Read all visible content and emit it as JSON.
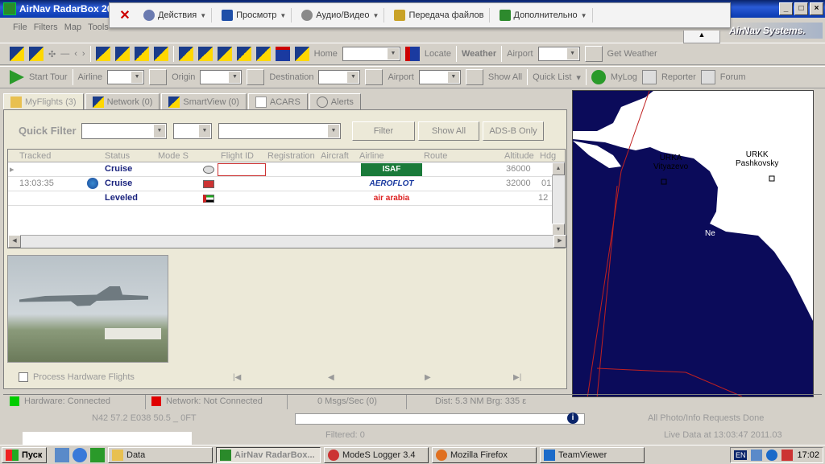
{
  "window": {
    "title": "AirNav RadarBox 20",
    "brand": "AirNav Systems."
  },
  "popup": {
    "items": [
      {
        "label": "Действия",
        "icon": "gear-icon",
        "color": "#6a7ab0"
      },
      {
        "label": "Просмотр",
        "icon": "monitor-icon",
        "color": "#1f4fa8"
      },
      {
        "label": "Аудио/Видео",
        "icon": "speaker-icon",
        "color": "#8a8a8a"
      },
      {
        "label": "Передача файлов",
        "icon": "file-transfer-icon",
        "color": "#c9a227"
      },
      {
        "label": "Дополнительно",
        "icon": "puzzle-icon",
        "color": "#2d8a2d"
      }
    ]
  },
  "menu": [
    "File",
    "Filters",
    "Map",
    "Tools"
  ],
  "toolbar1": {
    "home": "Home",
    "locate": "Locate",
    "weather": "Weather",
    "airport": "Airport",
    "get_weather": "Get Weather"
  },
  "toolbar2": {
    "start_tour": "Start Tour",
    "airline": "Airline",
    "origin": "Origin",
    "destination": "Destination",
    "airport": "Airport",
    "show_all": "Show All",
    "quick_list": "Quick List",
    "mylog": "MyLog",
    "reporter": "Reporter",
    "forum": "Forum"
  },
  "tabs": [
    {
      "label": "MyFlights (3)",
      "icon": "myflights-icon"
    },
    {
      "label": "Network (0)",
      "icon": "network-icon"
    },
    {
      "label": "SmartView (0)",
      "icon": "smartview-icon"
    },
    {
      "label": "ACARS",
      "icon": "acars-icon"
    },
    {
      "label": "Alerts",
      "icon": "alerts-icon"
    }
  ],
  "quick_filter": {
    "label": "Quick Filter",
    "filter_btn": "Filter",
    "show_all_btn": "Show All",
    "adsb_btn": "ADS-B Only"
  },
  "grid": {
    "columns": [
      "Tracked",
      "Status",
      "Mode S",
      "Flight ID",
      "Registration",
      "Aircraft",
      "Airline",
      "Route",
      "Altitude",
      "Hdg"
    ],
    "rows": [
      {
        "tracked": "",
        "status": "Cruise",
        "flag": "#d22",
        "airline": "ISAF",
        "airline_bg": "#1a7a3a",
        "airline_color": "#fff",
        "altitude": "36000",
        "hdg": ""
      },
      {
        "tracked": "13:03:35",
        "status": "Cruise",
        "flag": "#c33",
        "airline": "AEROFLOT",
        "airline_bg": "#fff",
        "airline_color": "#1a3aa0",
        "altitude": "32000",
        "hdg": "01:"
      },
      {
        "tracked": "",
        "status": "Leveled",
        "flag": "#2a2",
        "airline": "air arabia",
        "airline_bg": "#fff",
        "airline_color": "#d22",
        "altitude": "12",
        "hdg": ""
      }
    ]
  },
  "hardware_flights": "Process Hardware Flights",
  "map": {
    "labels": [
      {
        "code": "URKA",
        "name": "Vityazevo"
      },
      {
        "code": "URKK",
        "name": "Pashkovsky"
      },
      {
        "code": "Ne",
        "name": ""
      }
    ]
  },
  "status": {
    "hardware": "Hardware: Connected",
    "hardware_color": "#00cc00",
    "network": "Network: Not Connected",
    "network_color": "#e00000",
    "msgs": "0 Msgs/Sec (0)",
    "dist": "Dist: 5.3 NM   Brg: 335 ε"
  },
  "position": {
    "coord": "N42 57.2 E038 50.5 _ 0FT",
    "info_icon": "i",
    "done": "All Photo/Info Requests Done"
  },
  "bottom": {
    "filtered": "Filtered: 0",
    "live": "Live Data at 13:03:47 2011.03"
  },
  "taskbar": {
    "start": "Пуск",
    "tasks": [
      {
        "label": "Data",
        "icon": "folder-icon",
        "color": "#e8c050"
      },
      {
        "label": "AirNav RadarBox...",
        "icon": "radarbox-icon",
        "color": "#2a8a2a",
        "active": true
      },
      {
        "label": "ModeS Logger 3.4",
        "icon": "modes-logger-icon",
        "color": "#c33"
      },
      {
        "label": "Mozilla Firefox",
        "icon": "firefox-icon",
        "color": "#e07020"
      },
      {
        "label": "TeamViewer",
        "icon": "teamviewer-icon",
        "color": "#1a6ac9"
      }
    ],
    "lang": "EN",
    "clock": "17:02"
  }
}
